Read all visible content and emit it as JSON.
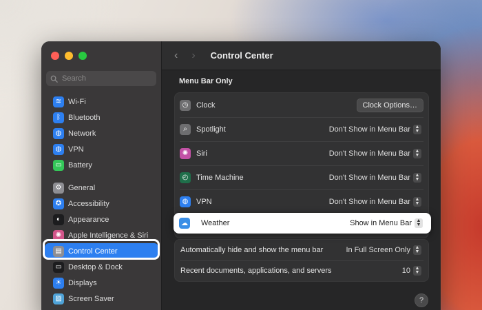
{
  "window": {
    "title": "Control Center",
    "nav": {
      "back_icon": "‹",
      "forward_icon": "›"
    }
  },
  "sidebar": {
    "search_placeholder": "Search",
    "items": [
      {
        "label": "Wi-Fi",
        "icon": "wifi-icon",
        "color": "#2d7ff0",
        "glyph": "≋"
      },
      {
        "label": "Bluetooth",
        "icon": "bluetooth-icon",
        "color": "#2d7ff0",
        "glyph": "ᛒ"
      },
      {
        "label": "Network",
        "icon": "network-icon",
        "color": "#2d7ff0",
        "glyph": "◍"
      },
      {
        "label": "VPN",
        "icon": "vpn-icon",
        "color": "#2d7ff0",
        "glyph": "◍"
      },
      {
        "label": "Battery",
        "icon": "battery-icon",
        "color": "#34c759",
        "glyph": "▭"
      },
      {
        "label": "General",
        "icon": "general-icon",
        "color": "#8e8e93",
        "glyph": "⚙"
      },
      {
        "label": "Accessibility",
        "icon": "accessibility-icon",
        "color": "#2d7ff0",
        "glyph": "✪"
      },
      {
        "label": "Appearance",
        "icon": "appearance-icon",
        "color": "#1c1c1e",
        "glyph": "◐"
      },
      {
        "label": "Apple Intelligence & Siri",
        "icon": "siri-icon",
        "color": "#d1558a",
        "glyph": "✺"
      },
      {
        "label": "Control Center",
        "icon": "control-center-icon",
        "color": "#8e8e93",
        "glyph": "▤"
      },
      {
        "label": "Desktop & Dock",
        "icon": "desktop-dock-icon",
        "color": "#1c1c1e",
        "glyph": "▭"
      },
      {
        "label": "Displays",
        "icon": "displays-icon",
        "color": "#2d7ff0",
        "glyph": "☀"
      },
      {
        "label": "Screen Saver",
        "icon": "screen-saver-icon",
        "color": "#4fa3d8",
        "glyph": "▨"
      }
    ],
    "selected": "Control Center"
  },
  "main": {
    "section_title": "Menu Bar Only",
    "rows": [
      {
        "label": "Clock",
        "icon": "clock-icon",
        "color": "#6e6e70",
        "glyph": "◷",
        "control": "Clock Options…",
        "type": "button"
      },
      {
        "label": "Spotlight",
        "icon": "spotlight-icon",
        "color": "#6e6e70",
        "glyph": "⌕",
        "control": "Don't Show in Menu Bar",
        "type": "popup"
      },
      {
        "label": "Siri",
        "icon": "siri-row-icon",
        "color": "#c352a6",
        "glyph": "✺",
        "control": "Don't Show in Menu Bar",
        "type": "popup"
      },
      {
        "label": "Time Machine",
        "icon": "time-machine-icon",
        "color": "#1f6f4a",
        "glyph": "◴",
        "control": "Don't Show in Menu Bar",
        "type": "popup"
      },
      {
        "label": "VPN",
        "icon": "vpn-row-icon",
        "color": "#2d7ff0",
        "glyph": "◍",
        "control": "Don't Show in Menu Bar",
        "type": "popup"
      }
    ],
    "weather": {
      "label": "Weather",
      "icon": "weather-icon",
      "glyph": "☁",
      "control": "Show in Menu Bar"
    },
    "bottom_rows": [
      {
        "label": "Automatically hide and show the menu bar",
        "control": "In Full Screen Only"
      },
      {
        "label": "Recent documents, applications, and servers",
        "control": "10"
      }
    ],
    "help_label": "?"
  }
}
